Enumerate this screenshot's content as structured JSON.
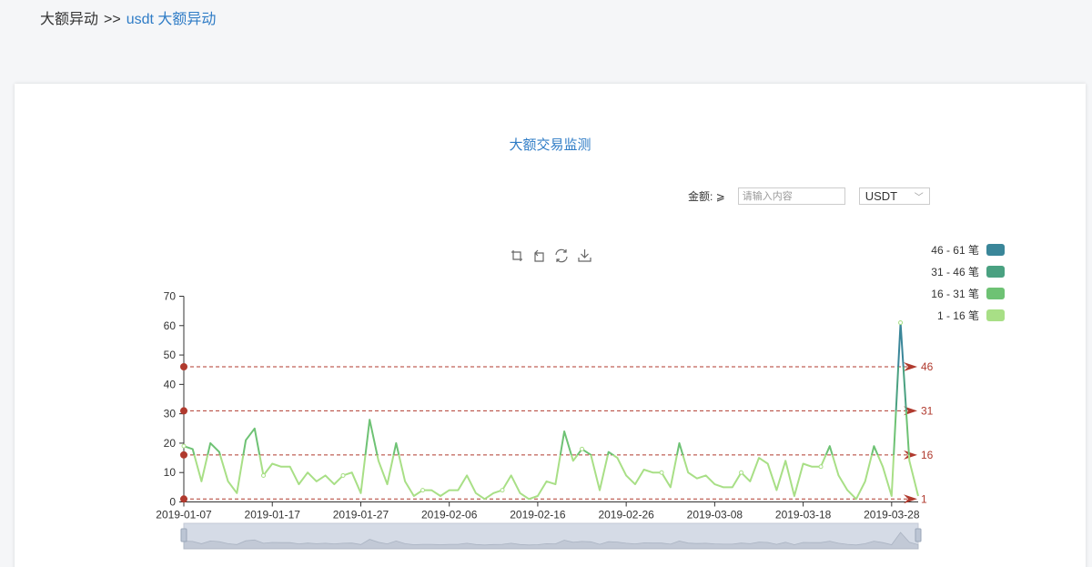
{
  "breadcrumb": {
    "parent": "大额异动",
    "separator": ">>",
    "current": "usdt 大额异动"
  },
  "panel": {
    "title": "大额交易监测",
    "amount_label": "金额: ⩾",
    "amount_placeholder": "请输入内容",
    "amount_value": "",
    "currency_selected": "USDT"
  },
  "toolbox": [
    "zoom-select-icon",
    "zoom-reset-icon",
    "restore-icon",
    "download-icon"
  ],
  "colors": {
    "accent": "#2f7cc6",
    "piece_46_61": "#3a8699",
    "piece_31_46": "#4aa181",
    "piece_16_31": "#6ec274",
    "piece_1_16": "#a8df86",
    "markline": "#b03a2e"
  },
  "chart_data": {
    "type": "line",
    "title": "",
    "xlabel": "",
    "ylabel": "",
    "ylim": [
      0,
      70
    ],
    "yticks": [
      0,
      10,
      20,
      30,
      40,
      50,
      60,
      70
    ],
    "x_start": "2019-01-07",
    "x_end": "2019-03-31",
    "xtick_labels": [
      "2019-01-07",
      "2019-01-17",
      "2019-01-27",
      "2019-02-06",
      "2019-02-16",
      "2019-02-26",
      "2019-03-08",
      "2019-03-18",
      "2019-03-28"
    ],
    "visual_map": [
      {
        "label": "46 - 61 笔",
        "min": 46,
        "max": 61,
        "color": "#3a8699"
      },
      {
        "label": "31 - 46 笔",
        "min": 31,
        "max": 46,
        "color": "#4aa181"
      },
      {
        "label": "16 - 31 笔",
        "min": 16,
        "max": 31,
        "color": "#6ec274"
      },
      {
        "label": "1 - 16 笔",
        "min": 1,
        "max": 16,
        "color": "#a8df86"
      }
    ],
    "mark_lines": [
      46,
      31,
      16,
      1
    ],
    "values": [
      19,
      18,
      7,
      20,
      17,
      7,
      3,
      21,
      25,
      9,
      13,
      12,
      12,
      6,
      10,
      7,
      9,
      6,
      9,
      10,
      3,
      28,
      14,
      6,
      20,
      7,
      2,
      4,
      4,
      2,
      4,
      4,
      9,
      3,
      1,
      3,
      4,
      9,
      3,
      1,
      2,
      7,
      6,
      24,
      14,
      18,
      16,
      4,
      17,
      15,
      9,
      6,
      11,
      10,
      10,
      5,
      20,
      10,
      8,
      9,
      6,
      5,
      5,
      10,
      7,
      15,
      13,
      4,
      14,
      2,
      13,
      12,
      12,
      19,
      9,
      4,
      1,
      7,
      19,
      12,
      2,
      61,
      14,
      2
    ]
  }
}
